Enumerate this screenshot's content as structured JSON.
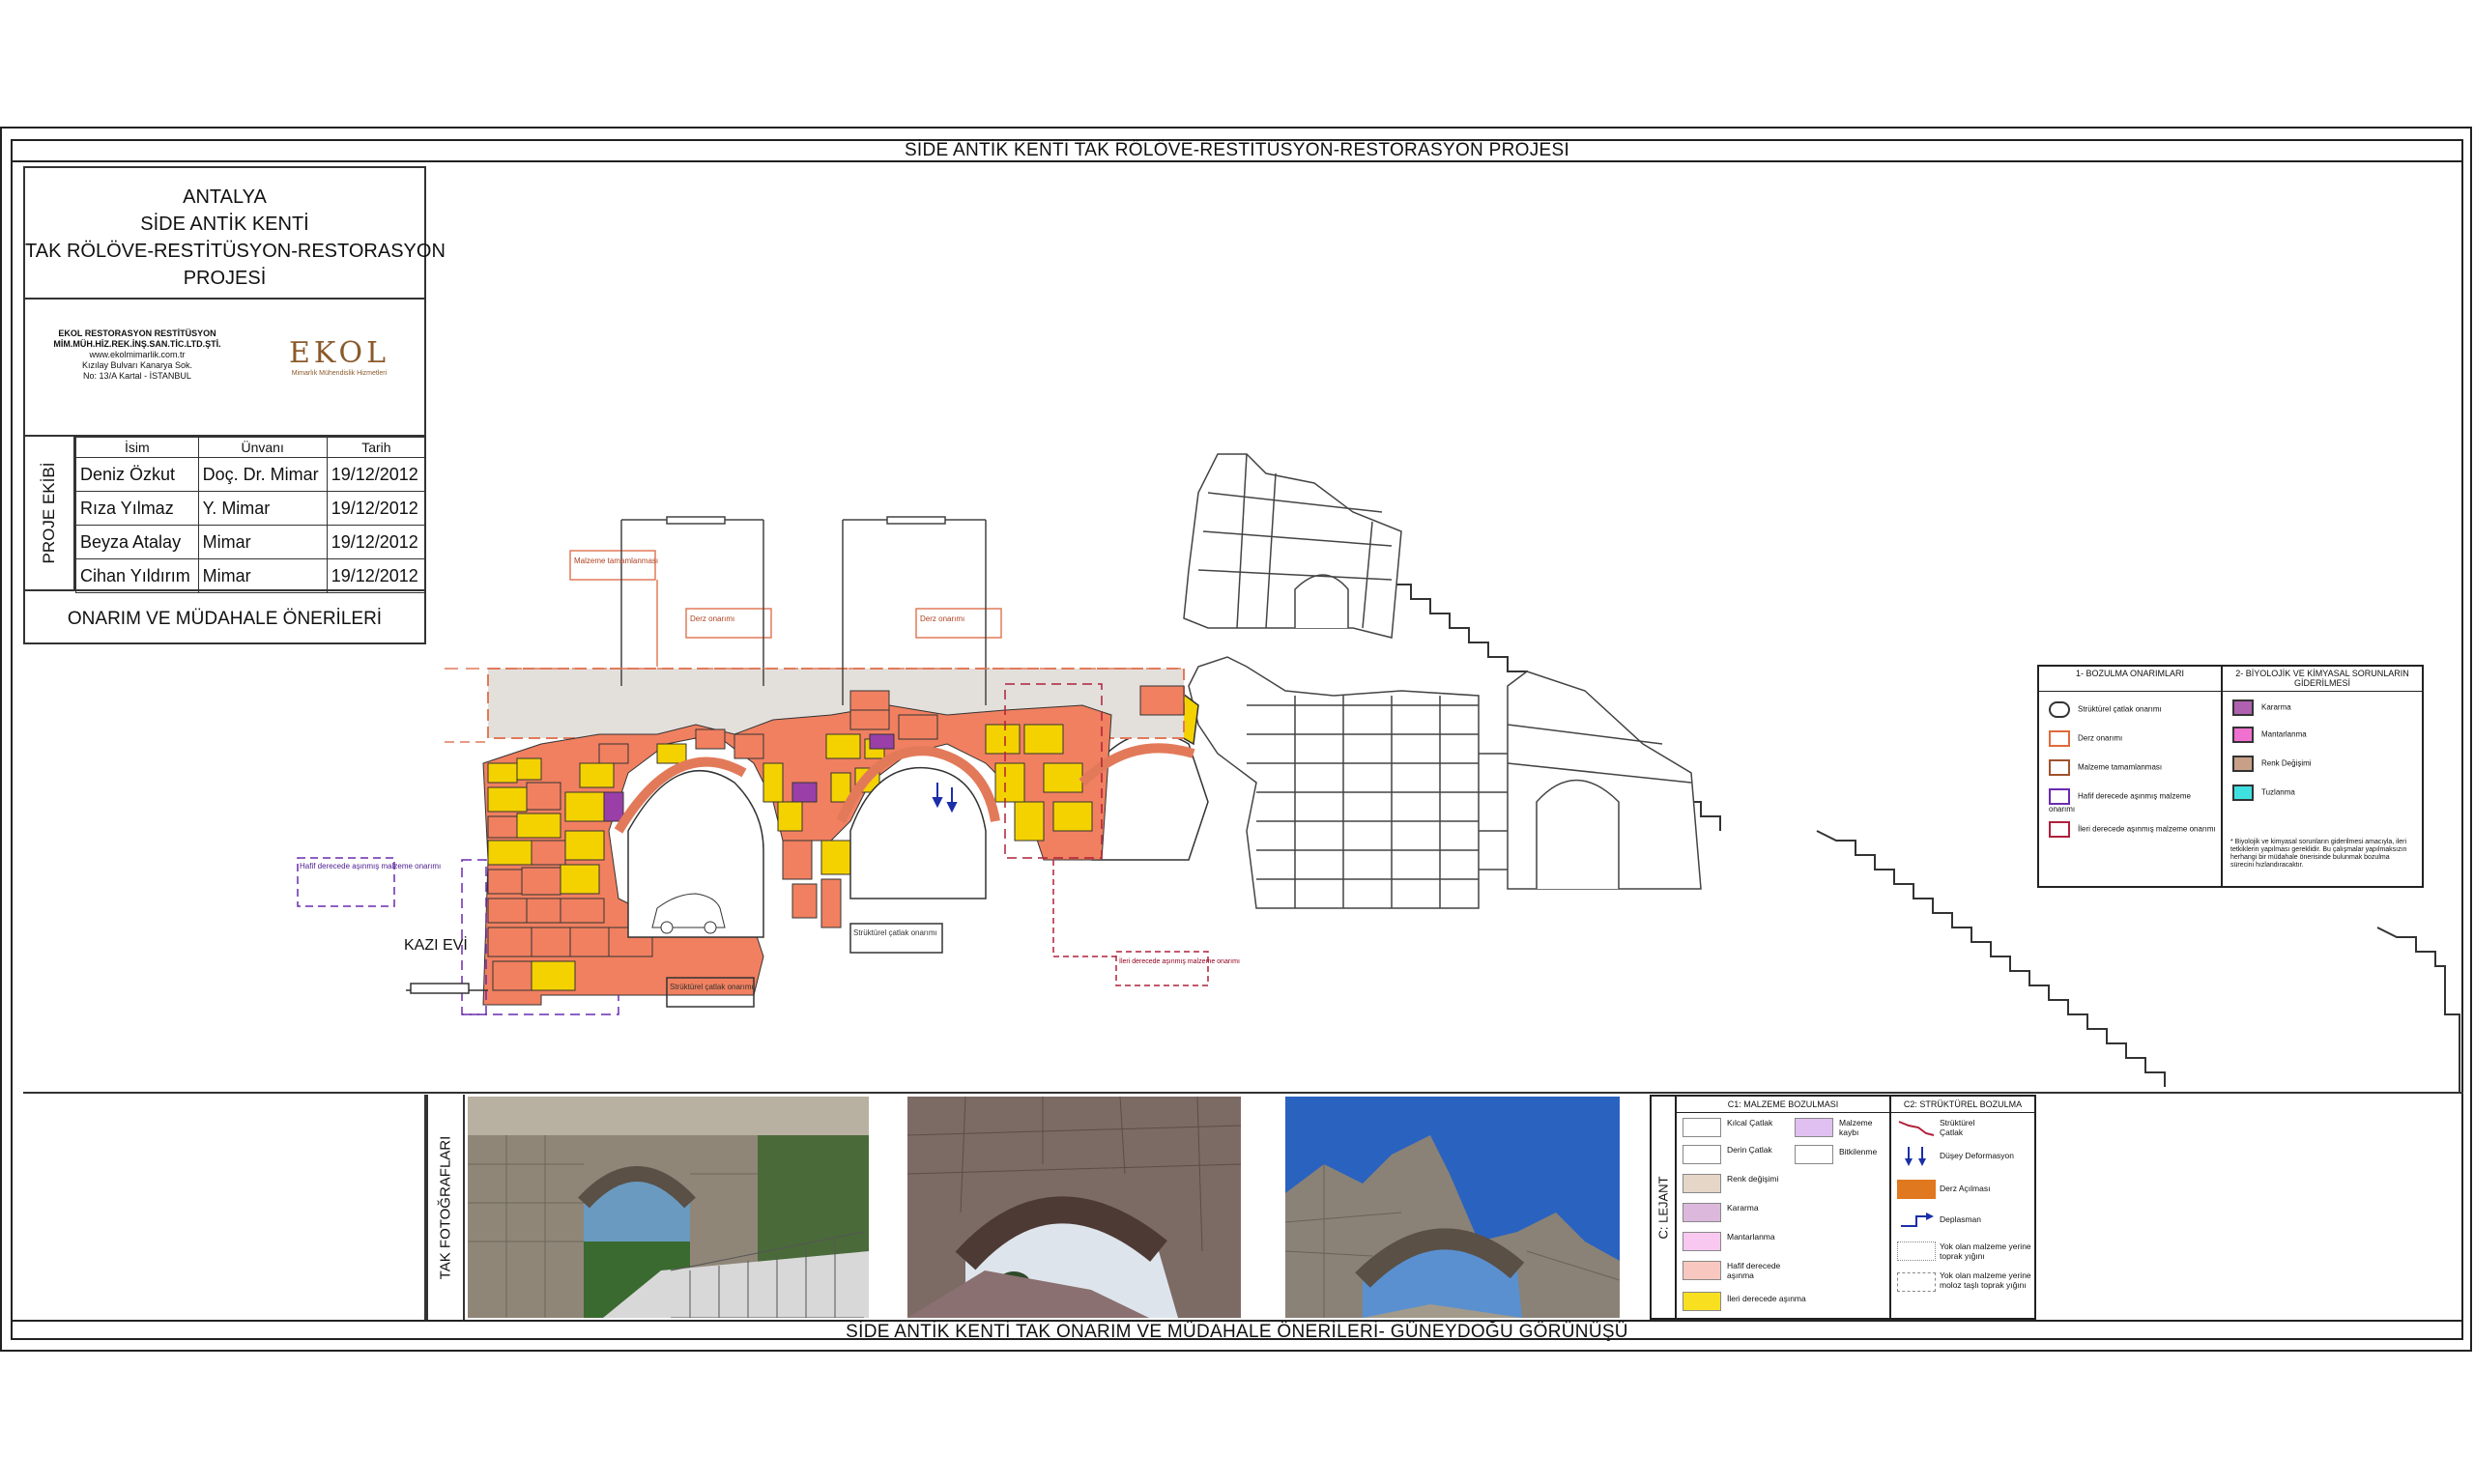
{
  "banners": {
    "top": "SİDE ANTİK KENTİ TAK  RÖLÖVE-RESTİTÜSYON-RESTORASYON PROJESİ",
    "bottom": "SİDE ANTİK KENTİ TAK  ONARIM VE MÜDAHALE ÖNERİLERİ- GÜNEYDOĞU GÖRÜNÜŞÜ"
  },
  "title_block": {
    "lines": [
      "ANTALYA",
      "SİDE ANTİK KENTİ",
      "TAK RÖLÖVE-RESTİTÜSYON-RESTORASYON",
      "PROJESİ"
    ]
  },
  "company": {
    "name1": "EKOL RESTORASYON RESTİTÜSYON",
    "name2": "MİM.MÜH.HİZ.REK.İNŞ.SAN.TİC.LTD.ŞTİ.",
    "web": "www.ekolmimarlik.com.tr",
    "addr1": "Kızılay Bulvarı Kanarya Sok.",
    "addr2": "No: 13/A Kartal - İSTANBUL",
    "logo": "EKOL",
    "logo_sub": "Mimarlık Mühendislik Hizmetleri"
  },
  "team": {
    "side_label": "PROJE EKİBİ",
    "headers": [
      "İsim",
      "Ünvanı",
      "Tarih"
    ],
    "rows": [
      {
        "name": "Deniz Özkut",
        "title": "Doç. Dr. Mimar",
        "date": "19/12/2012"
      },
      {
        "name": "Rıza Yılmaz",
        "title": "Y. Mimar",
        "date": "19/12/2012"
      },
      {
        "name": "Beyza Atalay",
        "title": "Mimar",
        "date": "19/12/2012"
      },
      {
        "name": "Cihan Yıldırım",
        "title": "Mimar",
        "date": "19/12/2012"
      }
    ]
  },
  "plan_title": "ONARIM VE MÜDAHALE ÖNERİLERİ",
  "drawing": {
    "kazi_evi": "KAZI EVİ",
    "callouts": {
      "malzeme": "Malzeme tamamlanması",
      "derz1": "Derz onarımı",
      "derz2": "Derz onarımı",
      "hafif": "Hafif derecede aşınmış malzeme onarımı",
      "strukturel1": "Strüktürel çatlak onarımı",
      "strukturel2": "Strüktürel çatlak onarımı",
      "ileri": "İleri derecede aşınmış malzeme onarımı"
    }
  },
  "legend_right": {
    "col1_title": "1- BOZULMA ONARIMLARI",
    "col2_title": "2- BİYOLOJİK VE KİMYASAL SORUNLARIN GİDERİLMESİ",
    "col1_items": [
      {
        "label": "Strüktürel çatlak onarımı",
        "color": "#ffffff",
        "border": "#333333"
      },
      {
        "label": "Derz onarımı",
        "color": "#ffffff",
        "border": "#e06a3a"
      },
      {
        "label": "Malzeme tamamlanması",
        "color": "#ffffff",
        "border": "#a0522d"
      },
      {
        "label": "Hafif derecede aşınmış malzeme onarımı",
        "color": "#ffffff",
        "border": "#6a2ab0"
      },
      {
        "label": "İleri derecede aşınmış malzeme onarımı",
        "color": "#ffffff",
        "border": "#b0203a"
      }
    ],
    "col2_items": [
      {
        "label": "Kararma",
        "color": "#b060b0"
      },
      {
        "label": "Mantarlanma",
        "color": "#f070d0"
      },
      {
        "label": "Renk Değişimi",
        "color": "#c8a088"
      },
      {
        "label": "Tuzlanma",
        "color": "#40e0e0"
      }
    ],
    "note": "* Biyolojik ve kimyasal sorunların giderilmesi amacıyla, ileri tetkiklerin yapılması gereklidir. Bu çalışmalar yapılmaksızın herhangi bir müdahale önerisinde bulunmak bozulma sürecini hızlandıracaktır."
  },
  "photos": {
    "label": "TAK FOTOĞRAFLARI"
  },
  "lejant": {
    "side_label": "C: LEJANT",
    "c1_title": "C1: MALZEME BOZULMASI",
    "c2_title": "C2: STRÜKTÜREL BOZULMA",
    "c1_items": [
      {
        "label": "Kılcal Çatlak",
        "color": "#ffffff"
      },
      {
        "label": "Derin Çatlak",
        "color": "#ffffff"
      },
      {
        "label": "Renk değişimi",
        "color": "#e6d6c8"
      },
      {
        "label": "Kararma",
        "color": "#dcb8dc"
      },
      {
        "label": "Mantarlanma",
        "color": "#f8c8f0"
      },
      {
        "label": "Hafif derecede aşınma",
        "color": "#f8c8c0"
      },
      {
        "label": "İleri derecede aşınma",
        "color": "#f8e020"
      }
    ],
    "c1_items_b": [
      {
        "label": "Malzeme kaybı",
        "color": "#e0c0f0"
      },
      {
        "label": "Bitkilenme",
        "color": "#ffffff"
      }
    ],
    "c2_items": [
      {
        "label": "Strüktürel Çatlak"
      },
      {
        "label": "Düşey Deformasyon"
      },
      {
        "label": "Derz Açılması",
        "color": "#e07820"
      },
      {
        "label": "Deplasman"
      },
      {
        "label": "Yok olan malzeme yerine toprak yığını"
      },
      {
        "label": "Yok olan malzeme yerine moloz taşlı toprak yığını"
      }
    ]
  }
}
